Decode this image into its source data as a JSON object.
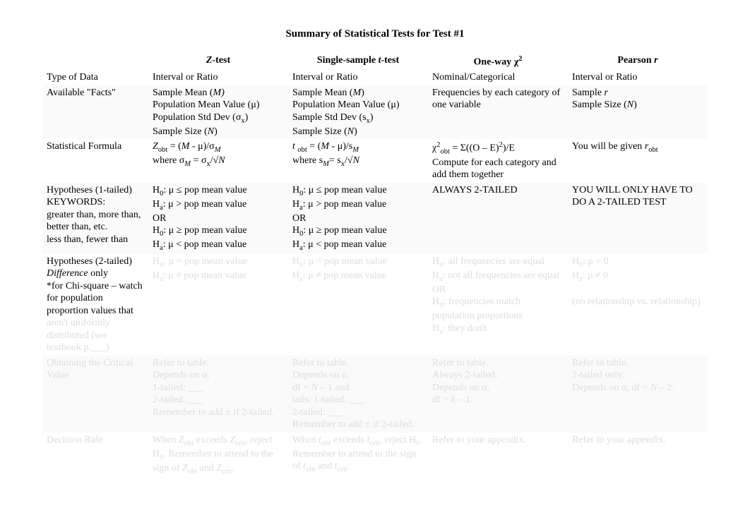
{
  "title": "Summary of Statistical Tests for Test #1",
  "headers": {
    "rowhead": "",
    "ztest": "Z-test",
    "ttest": "Single-sample t-test",
    "chi": "One-way χ²",
    "pearson": "Pearson r"
  },
  "rows": {
    "type_of_data": {
      "label": "Type of Data",
      "ztest": "Interval or Ratio",
      "ttest": "Interval or Ratio",
      "chi": "Nominal/Categorical",
      "pearson": "Interval or Ratio"
    },
    "facts": {
      "label": "Available \"Facts\"",
      "ztest": "Sample Mean (M)\nPopulation Mean Value (μ)\nPopulation Std Dev (σx)\nSample Size (N)",
      "ttest": "Sample Mean (M)\nPopulation Mean Value (μ)\nSample Std Dev (sx)\nSample Size (N)",
      "chi": "Frequencies by each category of one variable",
      "pearson": "Sample r\nSample Size (N)"
    },
    "formula": {
      "label": "Statistical Formula",
      "ztest": "Zobt = (M - μ)/σM\nwhere σM = σx/√N",
      "ttest": "t obt = (M - μ)/sM\nwhere sM = sx/√N",
      "chi": "χ²obt = Σ((O – E)²)/E\nCompute for each category and add them together",
      "pearson": "You will be given robt"
    },
    "hyp1": {
      "label": "Hypotheses (1-tailed)\nKEYWORDS:\ngreater than, more than, better than, etc.\nless than, fewer than",
      "ztest": "H0: μ ≤ pop mean value\nHa: μ > pop mean value\nOR\nH0: μ ≥ pop mean value\nHa: μ < pop mean value",
      "ttest": "H0: μ ≤ pop mean value\nHa: μ > pop mean value\nOR\nH0: μ ≥ pop mean value\nHa: μ < pop mean value",
      "chi": "ALWAYS 2-TAILED",
      "pearson": "YOU WILL ONLY HAVE TO DO A 2-TAILED TEST"
    },
    "hyp2": {
      "label": "Hypotheses (2-tailed)\nDifference only\n*for Chi-square – watch for population proportion values that aren't uniformly distributed (see textbook p.___)",
      "ztest": "H0: μ = pop mean value\nHa: μ ≠ pop mean value",
      "ttest": "H0: μ = pop mean value\nHa: μ ≠ pop mean value",
      "chi": "H0: all frequencies are equal\nHa: not all frequencies are equal\nOR\nH0: frequencies match population proportions\nHa: they don't",
      "pearson": "H0: ρ = 0\nHa: ρ ≠ 0\n\n(no relationship vs. relationship)"
    },
    "crit": {
      "label": "Obtaining the Critical Value",
      "ztest": "Refer to table.\nDepends on α.\n1-tailed: ___\n2-tailed: ___\nRemember to add ± if 2-tailed.",
      "ttest": "Refer to table.\nDepends on α,\ndf = N – 1 and\ntails. 1-tailed: ___\n2-tailed: ___\nRemember to add ± if 2-tailed.",
      "chi": "Refer to table.\nAlways 2-tailed.\nDepends on α,\ndf = k – 1.",
      "pearson": "Refer to table.\n2-tailed only.\nDepends on α, df = N – 2."
    },
    "decision": {
      "label": "Decision Rule",
      "ztest": "When Zobt exceeds Zcrit, reject H0. Remember to attend to the sign of Zobt and Zcrit.",
      "ttest": "When tobt exceeds tcrit, reject H0. Remember to attend to the sign of tobt and tcrit.",
      "chi": "Refer to your appendix.",
      "pearson": "Refer to your appendix."
    }
  }
}
